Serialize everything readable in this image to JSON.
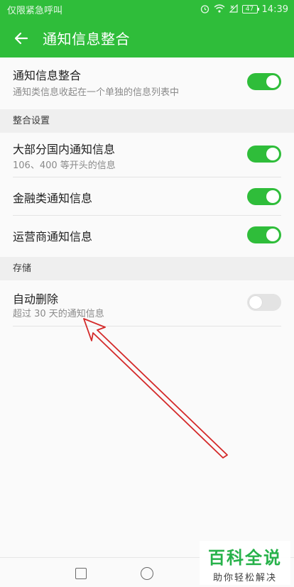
{
  "status_bar": {
    "carrier": "仅限紧急呼叫",
    "battery": "47",
    "time": "14:39",
    "icons": [
      "alarm-icon",
      "wifi-icon",
      "no-signal-icon",
      "battery-icon"
    ]
  },
  "app_bar": {
    "title": "通知信息整合",
    "back_icon": "arrow-left-icon"
  },
  "main_setting": {
    "title": "通知信息整合",
    "subtitle": "通知类信息收起在一个单独的信息列表中",
    "enabled": true
  },
  "sections": [
    {
      "header": "整合设置",
      "items": [
        {
          "title": "大部分国内通知信息",
          "subtitle": "106、400 等开头的信息",
          "enabled": true
        },
        {
          "title": "金融类通知信息",
          "enabled": true
        },
        {
          "title": "运营商通知信息",
          "enabled": true
        }
      ]
    },
    {
      "header": "存储",
      "items": [
        {
          "title": "自动删除",
          "subtitle": "超过 30 天的通知信息",
          "enabled": false
        }
      ]
    }
  ],
  "nav_bar": {
    "icons": [
      "recent-apps-icon",
      "home-icon"
    ]
  },
  "watermark": {
    "main": "百科全说",
    "sub": "助你轻松解决"
  },
  "colors": {
    "accent": "#2fbd3a",
    "annotation": "#d42a2a"
  }
}
